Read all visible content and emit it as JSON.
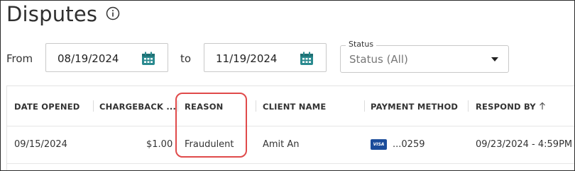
{
  "page": {
    "title": "Disputes"
  },
  "filters": {
    "from_label": "From",
    "from_date": "08/19/2024",
    "to_label": "to",
    "to_date": "11/19/2024",
    "status_label": "Status",
    "status_value": "Status (All)"
  },
  "table": {
    "columns": [
      "DATE OPENED",
      "CHARGEBACK ...",
      "REASON",
      "CLIENT NAME",
      "PAYMENT METHOD",
      "RESPOND BY"
    ],
    "sort": {
      "column": "RESPOND BY",
      "direction": "ascending",
      "icon": "arrow-up-icon"
    },
    "rows": [
      {
        "date_opened": "09/15/2024",
        "chargeback": "$1.00",
        "reason": "Fraudulent",
        "client_name": "Amit An",
        "payment_brand": "VISA",
        "payment_last4": "...0259",
        "respond_by": "09/23/2024 - 4:59PM"
      }
    ]
  },
  "annotation": {
    "highlight_color": "#e04a4a",
    "target": "REASON"
  },
  "icons": {
    "info": "info-icon",
    "calendar": "calendar-icon",
    "dropdown": "chevron-down-icon"
  }
}
